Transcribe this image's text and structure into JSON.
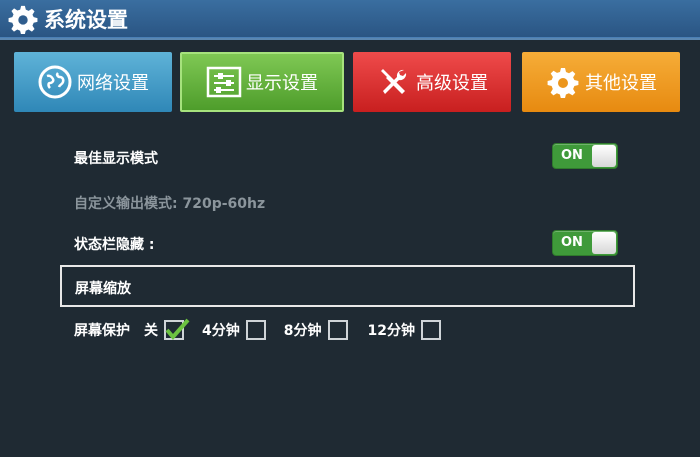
{
  "window": {
    "title": "系统设置"
  },
  "tabs": [
    {
      "label": "网络设置",
      "icon": "globe-icon",
      "color": "#3f9ccb"
    },
    {
      "label": "显示设置",
      "icon": "sliders-icon",
      "color": "#63b33f",
      "active": true
    },
    {
      "label": "高级设置",
      "icon": "tools-icon",
      "color": "#dd3333"
    },
    {
      "label": "其他设置",
      "icon": "gear-icon",
      "color": "#ef9a22"
    }
  ],
  "settings": {
    "best_display": {
      "label": "最佳显示模式",
      "toggle": "ON"
    },
    "output_mode": {
      "label": "自定义输出模式:  720p-60hz"
    },
    "statusbar": {
      "label": "状态栏隐藏  :",
      "toggle": "ON"
    },
    "zoom": {
      "label": "屏幕缩放"
    },
    "screensaver": {
      "label": "屏幕保护",
      "options": [
        {
          "label": "关",
          "checked": true
        },
        {
          "label": "4分钟",
          "checked": false
        },
        {
          "label": "8分钟",
          "checked": false
        },
        {
          "label": "12分钟",
          "checked": false
        }
      ]
    }
  }
}
